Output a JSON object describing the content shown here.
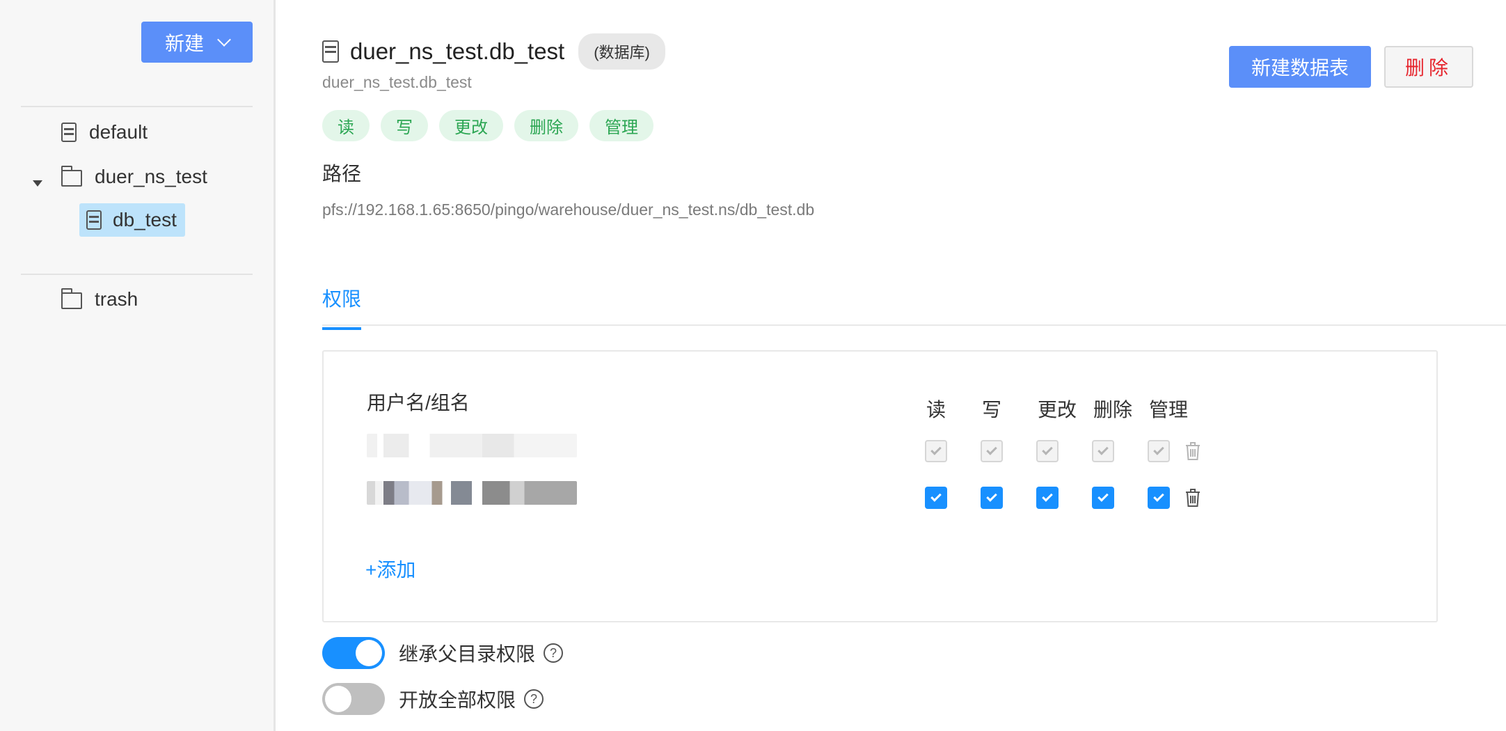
{
  "sidebar": {
    "new_button": "新建",
    "tree": [
      {
        "label": "default",
        "icon": "database-icon"
      },
      {
        "label": "duer_ns_test",
        "icon": "folder-icon",
        "expanded": true
      },
      {
        "label": "db_test",
        "icon": "database-icon",
        "selected": true
      },
      {
        "label": "trash",
        "icon": "folder-icon"
      }
    ]
  },
  "header": {
    "title": "duer_ns_test.db_test",
    "type_badge": "(数据库)",
    "subtitle": "duer_ns_test.db_test",
    "permission_tags": [
      "读",
      "写",
      "更改",
      "删除",
      "管理"
    ],
    "new_table_button": "新建数据表",
    "delete_button": "删除"
  },
  "path": {
    "label": "路径",
    "value": "pfs://192.168.1.65:8650/pingo/warehouse/duer_ns_test.ns/db_test.db"
  },
  "tabs": [
    {
      "label": "权限",
      "active": true
    }
  ],
  "permissions": {
    "column_user": "用户名/组名",
    "columns": [
      "读",
      "写",
      "更改",
      "删除",
      "管理"
    ],
    "rows": [
      {
        "name_redacted": true,
        "values": [
          true,
          true,
          true,
          true,
          true
        ],
        "disabled": true
      },
      {
        "name_redacted": true,
        "values": [
          true,
          true,
          true,
          true,
          true
        ],
        "disabled": false
      }
    ],
    "add_link": "+添加"
  },
  "switches": [
    {
      "label": "继承父目录权限",
      "on": true
    },
    {
      "label": "开放全部权限",
      "on": false
    }
  ],
  "colors": {
    "primary": "#5b8ff9",
    "link": "#1890ff",
    "danger": "#e6262e",
    "tag_green": "#2ca653",
    "selected_bg": "#bde3fb"
  }
}
